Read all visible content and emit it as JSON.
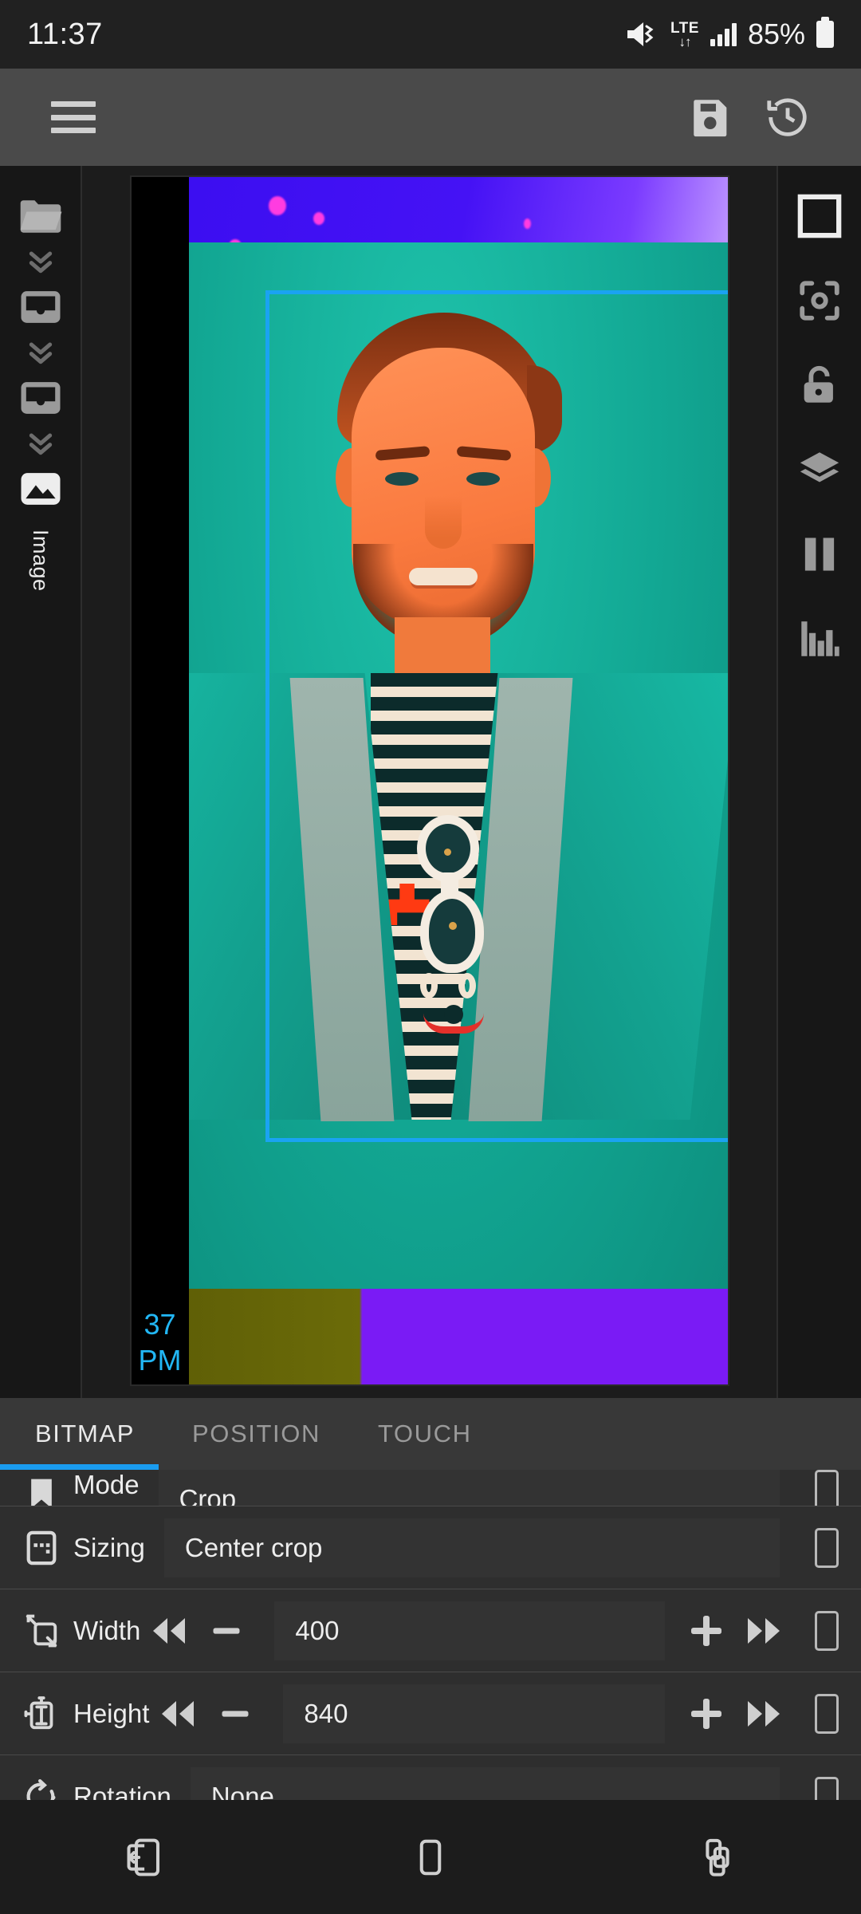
{
  "status_bar": {
    "clock": "11:37",
    "battery_percent": "85%",
    "network_type": "LTE",
    "icons": [
      "mute-vibrate-icon",
      "lte-icon",
      "signal-bars-icon",
      "battery-icon"
    ]
  },
  "toolbar": {
    "menu_icon": "hamburger-menu-icon",
    "save_icon": "save-floppy-icon",
    "history_icon": "history-clock-icon"
  },
  "left_rail": {
    "items": [
      {
        "icon": "folder-icon",
        "label": ""
      },
      {
        "icon": "chevron-double-down-icon",
        "label": ""
      },
      {
        "icon": "group-container-icon",
        "label": ""
      },
      {
        "icon": "chevron-double-down-icon",
        "label": ""
      },
      {
        "icon": "group-container-icon",
        "label": ""
      },
      {
        "icon": "chevron-double-down-icon",
        "label": ""
      },
      {
        "icon": "image-layer-icon",
        "label": "Image"
      }
    ],
    "selected_label": "Image"
  },
  "right_rail": {
    "items": [
      {
        "icon": "frame-square-icon"
      },
      {
        "icon": "focus-target-icon"
      },
      {
        "icon": "unlock-padlock-icon"
      },
      {
        "icon": "layers-icon"
      },
      {
        "icon": "pause-icon"
      },
      {
        "icon": "equalizer-bars-icon"
      }
    ]
  },
  "preview": {
    "clock_widget_line1": "37",
    "clock_widget_line2": "PM",
    "selection_color": "#1aa3f2",
    "description": "Color-inverted portrait photo of a man in a denim jacket over a striped shirt with sunglasses hanging from the collar"
  },
  "tabs": [
    {
      "label": "BITMAP",
      "active": true
    },
    {
      "label": "POSITION",
      "active": false
    },
    {
      "label": "TOUCH",
      "active": false
    }
  ],
  "properties": [
    {
      "name": "mode-row",
      "icon": "anchor-icon",
      "label": "Mode",
      "value": "Crop",
      "clipped": true,
      "has_stepper": false
    },
    {
      "name": "sizing-row",
      "icon": "sizing-icon",
      "label": "Sizing",
      "value": "Center crop",
      "clipped": false,
      "has_stepper": false
    },
    {
      "name": "width-row",
      "icon": "width-resize-icon",
      "label": "Width",
      "value": "400",
      "clipped": false,
      "has_stepper": true
    },
    {
      "name": "height-row",
      "icon": "height-resize-icon",
      "label": "Height",
      "value": "840",
      "clipped": false,
      "has_stepper": true
    },
    {
      "name": "rotation-row",
      "icon": "rotation-icon",
      "label": "Rotation",
      "value": "None",
      "clipped": false,
      "has_stepper": false
    }
  ],
  "stepper_icons": {
    "fast_backward": "double-left-arrow-icon",
    "decrement": "minus-icon",
    "increment": "plus-icon",
    "fast_forward": "double-right-arrow-icon"
  },
  "nav_bar": {
    "back_icon": "back-icon",
    "home_icon": "home-icon",
    "recents_icon": "recents-icon"
  },
  "colors": {
    "accent": "#1a9cf0",
    "toolbar_bg": "#4a4a4a",
    "panel_bg": "#2e2e2e",
    "rail_bg": "#171717",
    "selection": "#1aa3f2"
  }
}
